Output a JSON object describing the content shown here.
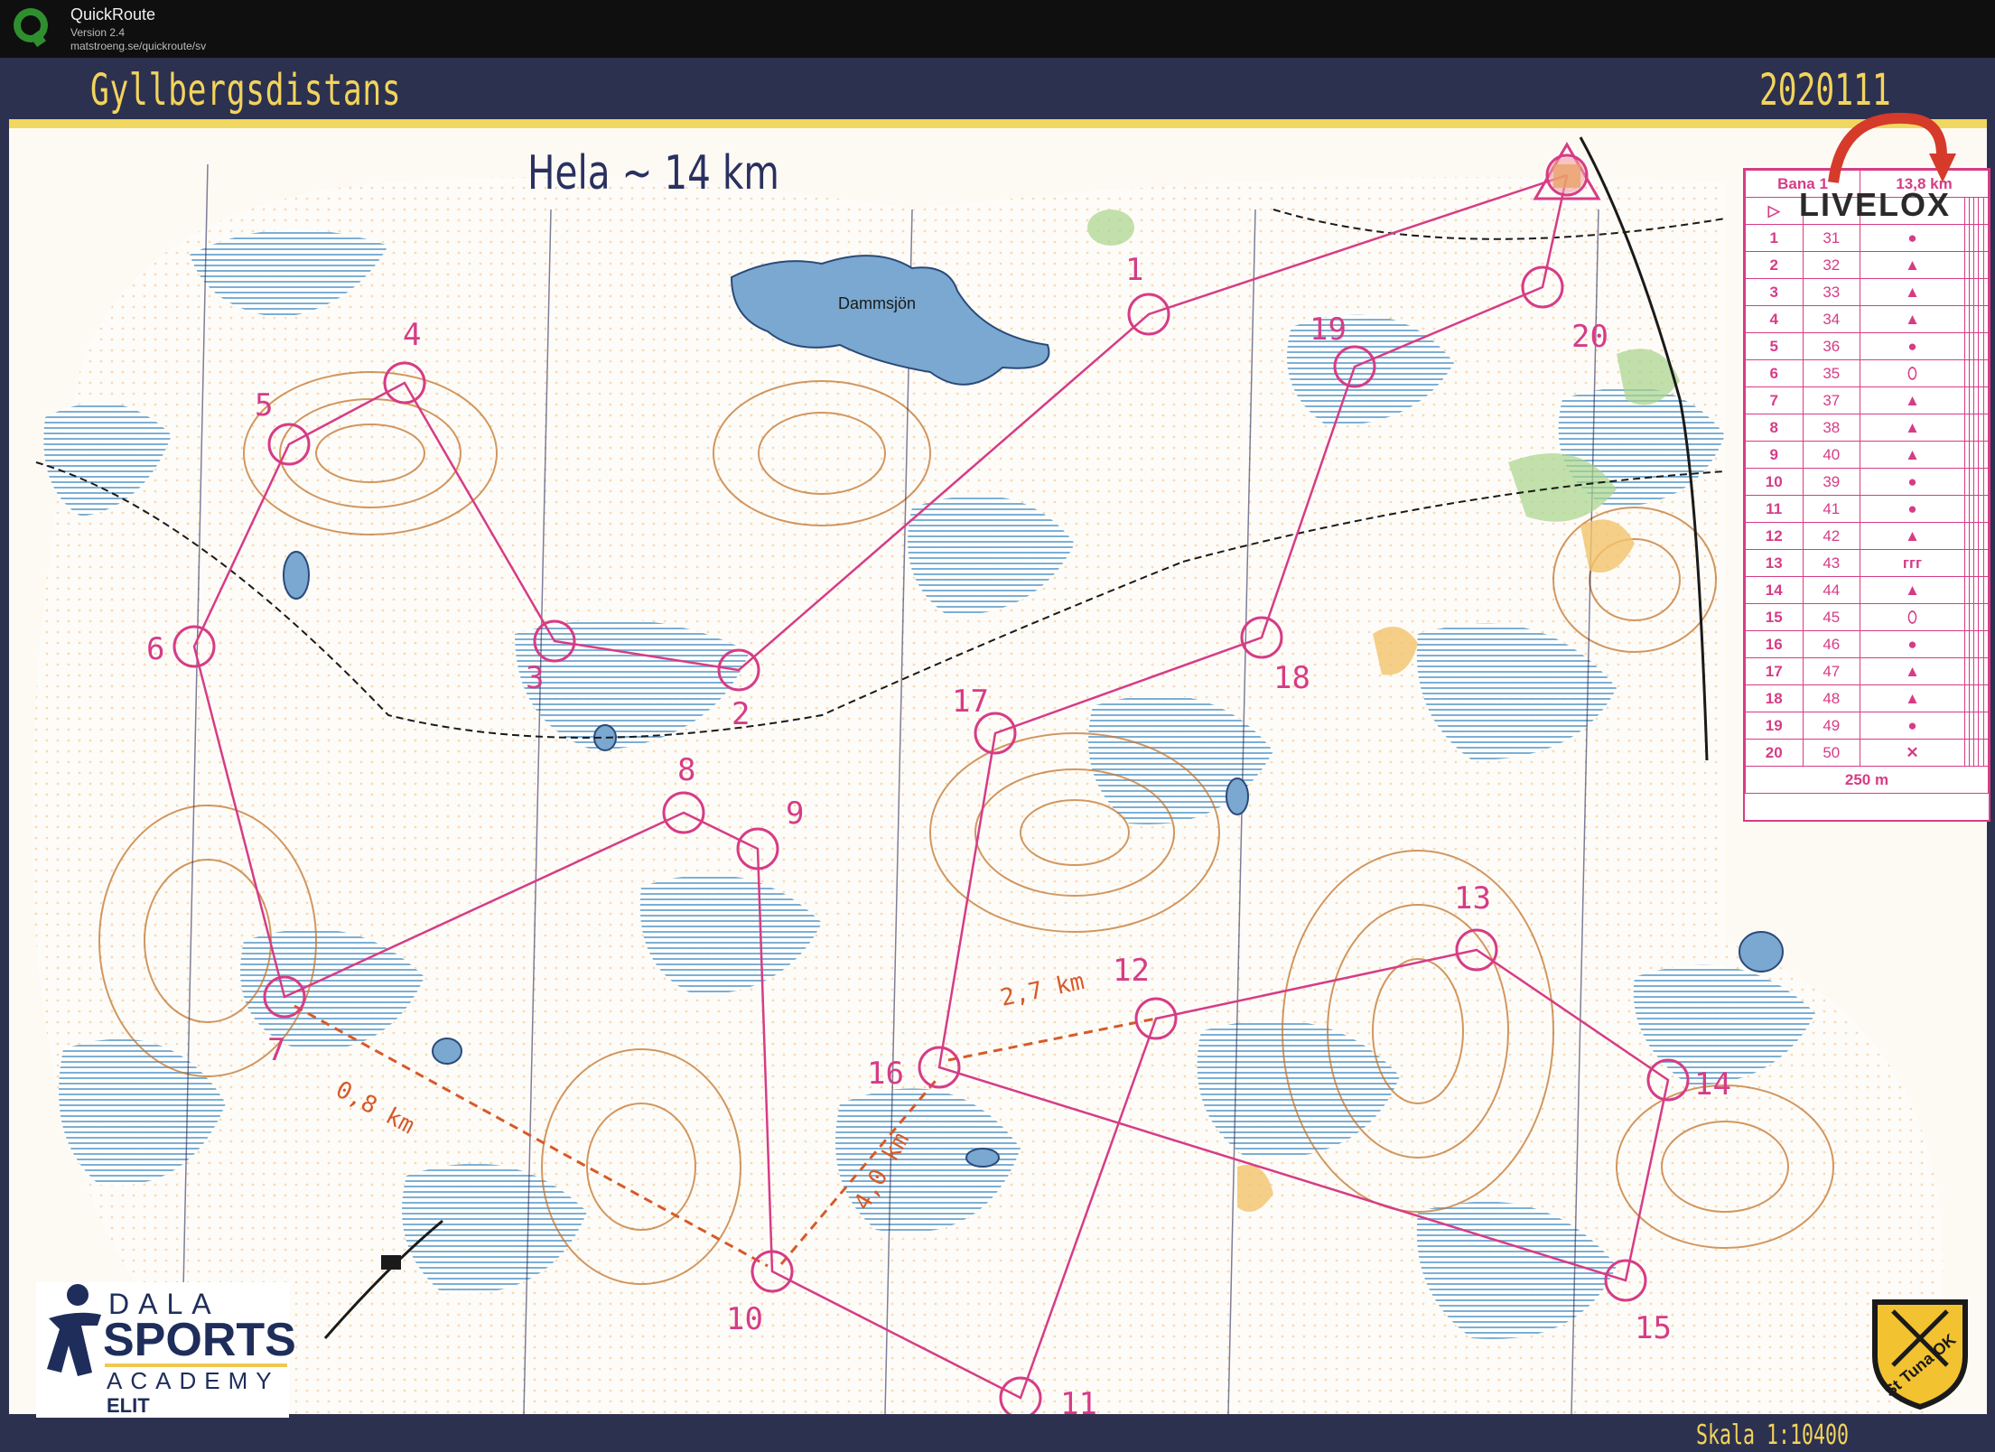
{
  "app": {
    "name": "QuickRoute",
    "version": "Version 2.4",
    "url": "matstroeng.se/quickroute/sv"
  },
  "map": {
    "title": "Gyllbergsdistans",
    "date": "2020111",
    "course_label": "Hela ~ 14 km",
    "lake_label": "Dammsjön",
    "scale": "Skala 1:10400",
    "leg_distances": [
      "2,7 km",
      "0,8 km",
      "4,0 km"
    ],
    "control_labels": [
      "1",
      "2",
      "3",
      "4",
      "5",
      "6",
      "7",
      "8",
      "9",
      "10",
      "11",
      "12",
      "13",
      "14",
      "15",
      "16",
      "17",
      "18",
      "19",
      "20"
    ]
  },
  "control_table": {
    "header_course": "Bana 1",
    "header_length": "13,8 km",
    "start_symbol": "▷",
    "rows": [
      {
        "num": "1",
        "code": "31",
        "sym": "●"
      },
      {
        "num": "2",
        "code": "32",
        "sym": "▲"
      },
      {
        "num": "3",
        "code": "33",
        "sym": "▲"
      },
      {
        "num": "4",
        "code": "34",
        "sym": "▲"
      },
      {
        "num": "5",
        "code": "36",
        "sym": "●"
      },
      {
        "num": "6",
        "code": "35",
        "sym": "⬯"
      },
      {
        "num": "7",
        "code": "37",
        "sym": "▲"
      },
      {
        "num": "8",
        "code": "38",
        "sym": "▲"
      },
      {
        "num": "9",
        "code": "40",
        "sym": "▲"
      },
      {
        "num": "10",
        "code": "39",
        "sym": "●"
      },
      {
        "num": "11",
        "code": "41",
        "sym": "●"
      },
      {
        "num": "12",
        "code": "42",
        "sym": "▲"
      },
      {
        "num": "13",
        "code": "43",
        "sym": "ᴦᴦᴦ"
      },
      {
        "num": "14",
        "code": "44",
        "sym": "▲"
      },
      {
        "num": "15",
        "code": "45",
        "sym": "⬯"
      },
      {
        "num": "16",
        "code": "46",
        "sym": "●"
      },
      {
        "num": "17",
        "code": "47",
        "sym": "▲"
      },
      {
        "num": "18",
        "code": "48",
        "sym": "▲"
      },
      {
        "num": "19",
        "code": "49",
        "sym": "●"
      },
      {
        "num": "20",
        "code": "50",
        "sym": "✕"
      }
    ],
    "footer_distance": "250 m"
  },
  "badges": {
    "livelox": "LIVELOX",
    "academy_top": "DALA",
    "academy_main": "SPORTS",
    "academy_sub": "ACADEMY",
    "academy_level": "ELIT",
    "club": "St Tuna OK"
  },
  "colors": {
    "frame": "#2d3150",
    "accent_gold": "#f2d45c",
    "course_magenta": "#d63c86",
    "water_blue": "#7aa8d0",
    "contour_brown": "#c2762f"
  }
}
